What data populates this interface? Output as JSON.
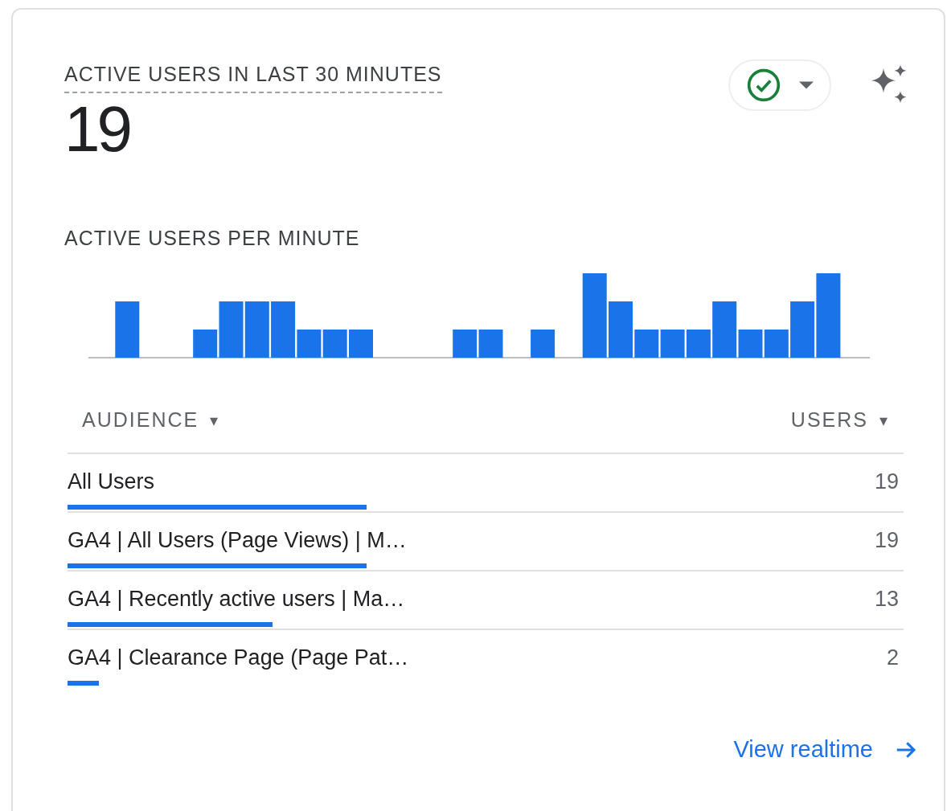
{
  "card": {
    "title": "ACTIVE USERS IN LAST 30 MINUTES",
    "value": "19",
    "chart_title": "ACTIVE USERS PER MINUTE",
    "table": {
      "columns": [
        {
          "label": "AUDIENCE",
          "caret": "▾"
        },
        {
          "label": "USERS",
          "caret": "▾"
        }
      ],
      "rows": [
        {
          "name": "All Users",
          "users": "19"
        },
        {
          "name": "GA4 | All Users (Page Views) | M…",
          "users": "19"
        },
        {
          "name": "GA4 | Recently active users | Ma…",
          "users": "13"
        },
        {
          "name": "GA4 | Clearance Page (Page Pat…",
          "users": "2"
        }
      ]
    },
    "link": "View realtime"
  }
}
